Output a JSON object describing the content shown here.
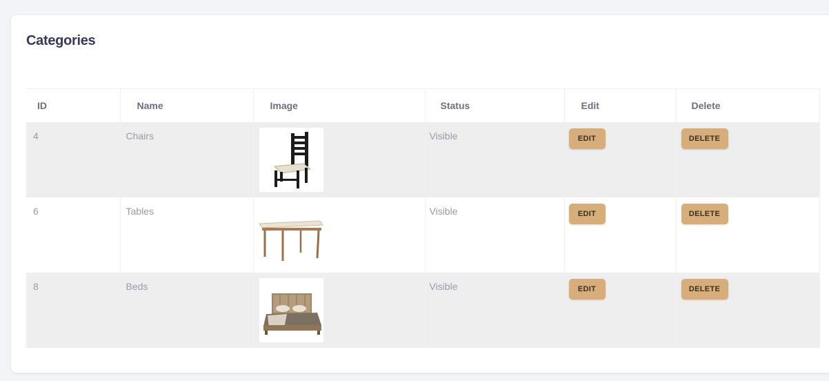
{
  "page": {
    "title": "Categories"
  },
  "table": {
    "headers": [
      "ID",
      "Name",
      "Image",
      "Status",
      "Edit",
      "Delete"
    ],
    "rows": [
      {
        "id": "4",
        "name": "Chairs",
        "image": "chair",
        "status": "Visible",
        "edit_label": "EDIT",
        "delete_label": "DELETE"
      },
      {
        "id": "6",
        "name": "Tables",
        "image": "table",
        "status": "Visible",
        "edit_label": "EDIT",
        "delete_label": "DELETE"
      },
      {
        "id": "8",
        "name": "Beds",
        "image": "bed",
        "status": "Visible",
        "edit_label": "EDIT",
        "delete_label": "DELETE"
      }
    ]
  },
  "colors": {
    "button": "#d7ae7a",
    "row_shade": "#eeeeee",
    "title": "#34395e"
  }
}
